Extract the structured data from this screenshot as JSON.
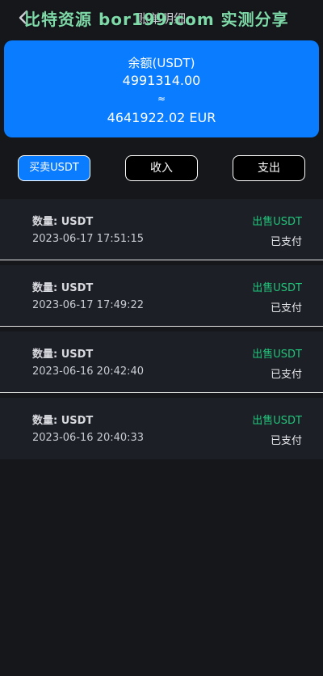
{
  "header": {
    "title": "账单明细",
    "watermark": "比特资源 bor199.com 实测分享"
  },
  "balance": {
    "label": "余额(USDT)",
    "amount": "4991314.00",
    "approx": "≈",
    "converted": "4641922.02 EUR"
  },
  "tabs": [
    {
      "label": "买卖USDT",
      "active": true
    },
    {
      "label": "收入",
      "active": false
    },
    {
      "label": "支出",
      "active": false
    }
  ],
  "records": [
    {
      "qty": "数量: USDT",
      "time": "2023-06-17 17:51:15",
      "type": "出售USDT",
      "status": "已支付"
    },
    {
      "qty": "数量: USDT",
      "time": "2023-06-17 17:49:22",
      "type": "出售USDT",
      "status": "已支付"
    },
    {
      "qty": "数量: USDT",
      "time": "2023-06-16 20:42:40",
      "type": "出售USDT",
      "status": "已支付"
    },
    {
      "qty": "数量: USDT",
      "time": "2023-06-16 20:40:33",
      "type": "出售USDT",
      "status": "已支付"
    }
  ],
  "colors": {
    "accent": "#0a7cff",
    "sell": "#20c47a",
    "background": "#15171b",
    "row": "#1d1f26"
  },
  "icons": {
    "back": "chevron-left-icon"
  }
}
